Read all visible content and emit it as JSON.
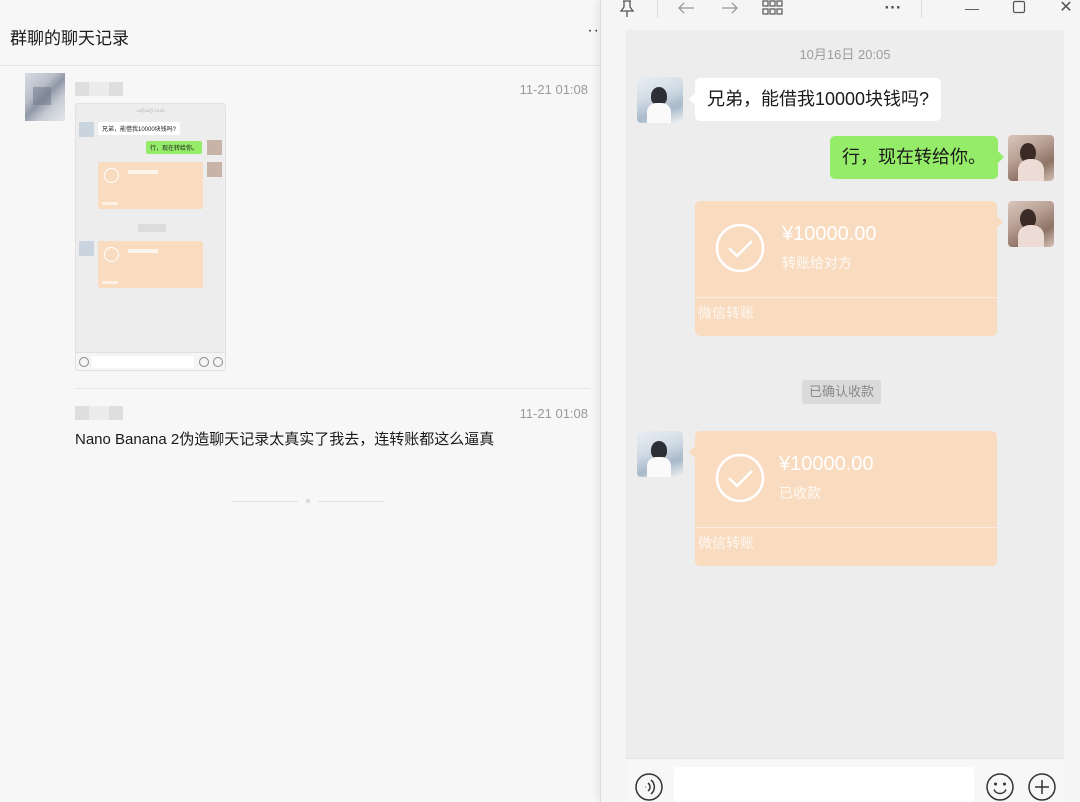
{
  "left": {
    "title": "群聊的聊天记录",
    "more": "··",
    "messages": [
      {
        "time": "11-21 01:08"
      },
      {
        "time": "11-21 01:08",
        "text": "Nano Banana 2伪造聊天记录太真实了我去，连转账都这么逼真"
      }
    ],
    "thumbnail": {
      "time": "10月16日 20:05",
      "text1": "兄弟，能借我10000块钱吗?",
      "text2": "行，现在转给你。"
    }
  },
  "viewer": {
    "toolbar": {
      "pin_icon": "pin-icon",
      "back_icon": "arrow-left-icon",
      "forward_icon": "arrow-right-icon",
      "grid_icon": "grid-icon",
      "more": "···",
      "minimize": "—",
      "maximize_icon": "maximize-icon",
      "close": "✕"
    },
    "chat": {
      "time": "10月16日 20:05",
      "friend_message": "兄弟，能借我10000块钱吗?",
      "my_message": "行，现在转给你。",
      "transfer_sent": {
        "amount": "¥10000.00",
        "status": "转账给对方",
        "brand": "微信转账"
      },
      "system_note": "已确认收款",
      "transfer_received": {
        "amount": "¥10000.00",
        "status": "已收款",
        "brand": "微信转账"
      }
    },
    "colors": {
      "green_bubble": "#95ec69",
      "transfer_card": "#f9dbbf",
      "chat_bg": "#ededed"
    }
  }
}
